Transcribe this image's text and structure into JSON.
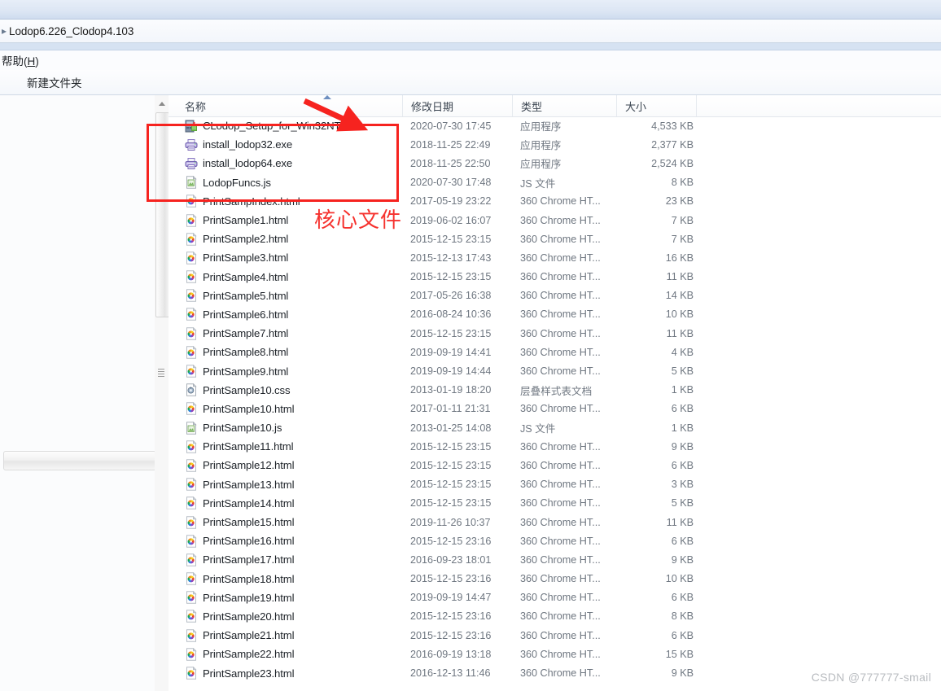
{
  "window": {
    "breadcrumb_separator": "▸",
    "breadcrumb_text": "Lodop6.226_Clodop4.103"
  },
  "menu_bar": {
    "items": [
      {
        "label_prefix": "帮助(",
        "mnemonic": "H",
        "label_suffix": ")"
      }
    ]
  },
  "command_bar": {
    "new_folder_label": "新建文件夹"
  },
  "columns": [
    {
      "key": "name",
      "label": "名称"
    },
    {
      "key": "date",
      "label": "修改日期"
    },
    {
      "key": "type",
      "label": "类型"
    },
    {
      "key": "size",
      "label": "大小"
    }
  ],
  "files": [
    {
      "name": "CLodop_Setup_for_Win32NT.exe",
      "date": "2020-07-30 17:45",
      "type": "应用程序",
      "size": "4,533 KB",
      "icon": "installer-icon"
    },
    {
      "name": "install_lodop32.exe",
      "date": "2018-11-25 22:49",
      "type": "应用程序",
      "size": "2,377 KB",
      "icon": "printer-icon"
    },
    {
      "name": "install_lodop64.exe",
      "date": "2018-11-25 22:50",
      "type": "应用程序",
      "size": "2,524 KB",
      "icon": "printer-icon"
    },
    {
      "name": "LodopFuncs.js",
      "date": "2020-07-30 17:48",
      "type": "JS 文件",
      "size": "8 KB",
      "icon": "js-file-icon"
    },
    {
      "name": "PrintSampIndex.html",
      "date": "2017-05-19 23:22",
      "type": "360 Chrome HT...",
      "size": "23 KB",
      "icon": "html-file-icon"
    },
    {
      "name": "PrintSample1.html",
      "date": "2019-06-02 16:07",
      "type": "360 Chrome HT...",
      "size": "7 KB",
      "icon": "html-file-icon"
    },
    {
      "name": "PrintSample2.html",
      "date": "2015-12-15 23:15",
      "type": "360 Chrome HT...",
      "size": "7 KB",
      "icon": "html-file-icon"
    },
    {
      "name": "PrintSample3.html",
      "date": "2015-12-13 17:43",
      "type": "360 Chrome HT...",
      "size": "16 KB",
      "icon": "html-file-icon"
    },
    {
      "name": "PrintSample4.html",
      "date": "2015-12-15 23:15",
      "type": "360 Chrome HT...",
      "size": "11 KB",
      "icon": "html-file-icon"
    },
    {
      "name": "PrintSample5.html",
      "date": "2017-05-26 16:38",
      "type": "360 Chrome HT...",
      "size": "14 KB",
      "icon": "html-file-icon"
    },
    {
      "name": "PrintSample6.html",
      "date": "2016-08-24 10:36",
      "type": "360 Chrome HT...",
      "size": "10 KB",
      "icon": "html-file-icon"
    },
    {
      "name": "PrintSample7.html",
      "date": "2015-12-15 23:15",
      "type": "360 Chrome HT...",
      "size": "11 KB",
      "icon": "html-file-icon"
    },
    {
      "name": "PrintSample8.html",
      "date": "2019-09-19 14:41",
      "type": "360 Chrome HT...",
      "size": "4 KB",
      "icon": "html-file-icon"
    },
    {
      "name": "PrintSample9.html",
      "date": "2019-09-19 14:44",
      "type": "360 Chrome HT...",
      "size": "5 KB",
      "icon": "html-file-icon"
    },
    {
      "name": "PrintSample10.css",
      "date": "2013-01-19 18:20",
      "type": "层叠样式表文档",
      "size": "1 KB",
      "icon": "css-file-icon"
    },
    {
      "name": "PrintSample10.html",
      "date": "2017-01-11 21:31",
      "type": "360 Chrome HT...",
      "size": "6 KB",
      "icon": "html-file-icon"
    },
    {
      "name": "PrintSample10.js",
      "date": "2013-01-25 14:08",
      "type": "JS 文件",
      "size": "1 KB",
      "icon": "js-file-icon"
    },
    {
      "name": "PrintSample11.html",
      "date": "2015-12-15 23:15",
      "type": "360 Chrome HT...",
      "size": "9 KB",
      "icon": "html-file-icon"
    },
    {
      "name": "PrintSample12.html",
      "date": "2015-12-15 23:15",
      "type": "360 Chrome HT...",
      "size": "6 KB",
      "icon": "html-file-icon"
    },
    {
      "name": "PrintSample13.html",
      "date": "2015-12-15 23:15",
      "type": "360 Chrome HT...",
      "size": "3 KB",
      "icon": "html-file-icon"
    },
    {
      "name": "PrintSample14.html",
      "date": "2015-12-15 23:15",
      "type": "360 Chrome HT...",
      "size": "5 KB",
      "icon": "html-file-icon"
    },
    {
      "name": "PrintSample15.html",
      "date": "2019-11-26 10:37",
      "type": "360 Chrome HT...",
      "size": "11 KB",
      "icon": "html-file-icon"
    },
    {
      "name": "PrintSample16.html",
      "date": "2015-12-15 23:16",
      "type": "360 Chrome HT...",
      "size": "6 KB",
      "icon": "html-file-icon"
    },
    {
      "name": "PrintSample17.html",
      "date": "2016-09-23 18:01",
      "type": "360 Chrome HT...",
      "size": "9 KB",
      "icon": "html-file-icon"
    },
    {
      "name": "PrintSample18.html",
      "date": "2015-12-15 23:16",
      "type": "360 Chrome HT...",
      "size": "10 KB",
      "icon": "html-file-icon"
    },
    {
      "name": "PrintSample19.html",
      "date": "2019-09-19 14:47",
      "type": "360 Chrome HT...",
      "size": "6 KB",
      "icon": "html-file-icon"
    },
    {
      "name": "PrintSample20.html",
      "date": "2015-12-15 23:16",
      "type": "360 Chrome HT...",
      "size": "8 KB",
      "icon": "html-file-icon"
    },
    {
      "name": "PrintSample21.html",
      "date": "2015-12-15 23:16",
      "type": "360 Chrome HT...",
      "size": "6 KB",
      "icon": "html-file-icon"
    },
    {
      "name": "PrintSample22.html",
      "date": "2016-09-19 13:18",
      "type": "360 Chrome HT...",
      "size": "15 KB",
      "icon": "html-file-icon"
    },
    {
      "name": "PrintSample23.html",
      "date": "2016-12-13 11:46",
      "type": "360 Chrome HT...",
      "size": "9 KB",
      "icon": "html-file-icon"
    }
  ],
  "annotations": {
    "label": "核心文件",
    "color": "#f6231f"
  },
  "watermark": {
    "text": "CSDN @777777-smail"
  },
  "colors": {
    "accent_blue": "#d6e2f2",
    "annotation_red": "#f6231f",
    "text_primary": "#1d2228",
    "text_secondary": "#6f7781"
  }
}
